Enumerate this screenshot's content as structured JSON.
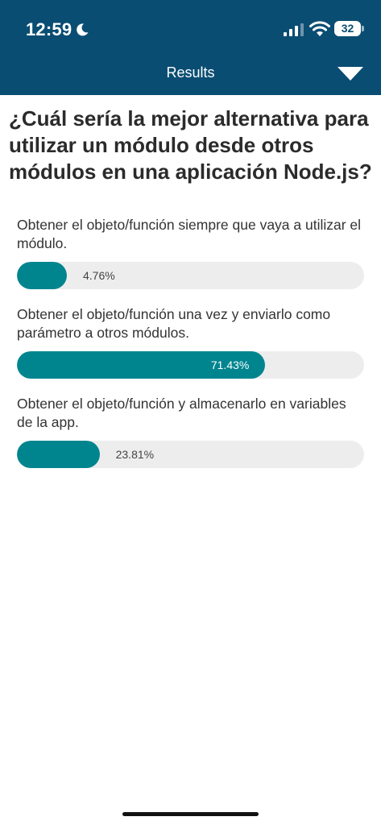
{
  "status_bar": {
    "time": "12:59",
    "battery": "32"
  },
  "header": {
    "title": "Results"
  },
  "question": "¿Cuál sería la mejor alternativa para utilizar un módulo desde otros módulos en una aplicación Node.js?",
  "options": [
    {
      "label": "Obtener el objeto/función siempre que vaya a utilizar el módulo.",
      "percent_label": "4.76%",
      "percent": 4.76
    },
    {
      "label": "Obtener el objeto/función una vez y enviarlo como parámetro a otros módulos.",
      "percent_label": "71.43%",
      "percent": 71.43
    },
    {
      "label": "Obtener el objeto/función y almacenarlo en variables de la app.",
      "percent_label": "23.81%",
      "percent": 23.81
    }
  ],
  "colors": {
    "header": "#0a4d73",
    "bar_fill": "#00858f",
    "bar_track": "#ededed"
  },
  "icons": [
    "moon-icon",
    "signal-icon",
    "wifi-icon",
    "battery-icon",
    "chevron-down-icon"
  ]
}
